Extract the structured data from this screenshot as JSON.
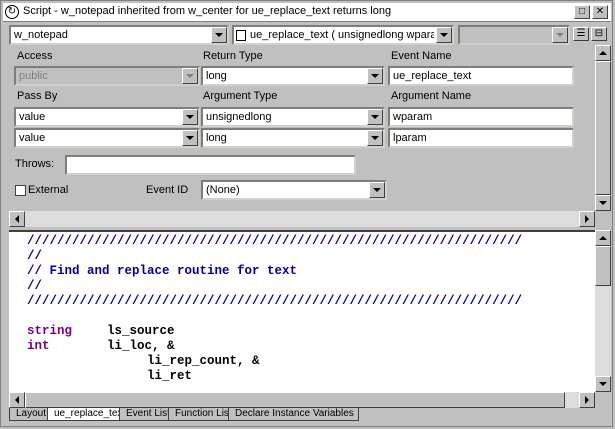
{
  "window": {
    "title": "Script - w_notepad inherited from w_center for ue_replace_text returns long"
  },
  "toolbar": {
    "object_select": "w_notepad",
    "event_select": "ue_replace_text ( unsignedlong wparar",
    "ancestor_select": ""
  },
  "labels": {
    "access": "Access",
    "return_type": "Return Type",
    "event_name": "Event Name",
    "pass_by": "Pass By",
    "argument_type": "Argument Type",
    "argument_name": "Argument Name",
    "throws": "Throws:",
    "external": "External",
    "event_id": "Event ID"
  },
  "fields": {
    "access": "public",
    "return_type": "long",
    "event_name": "ue_replace_text",
    "throws": "",
    "external_checked": false,
    "event_id": "(None)"
  },
  "arguments": [
    {
      "pass_by": "value",
      "type": "unsignedlong",
      "name": "wparam"
    },
    {
      "pass_by": "value",
      "type": "long",
      "name": "lparam"
    }
  ],
  "code": {
    "lines": [
      {
        "kind": "comment",
        "text": "//////////////////////////////////////////////////////////////////"
      },
      {
        "kind": "comment",
        "text": "//"
      },
      {
        "kind": "comment",
        "text": "// Find and replace routine for text"
      },
      {
        "kind": "comment",
        "text": "//"
      },
      {
        "kind": "comment",
        "text": "//////////////////////////////////////////////////////////////////"
      },
      {
        "kind": "blank",
        "text": ""
      },
      {
        "kind": "decl",
        "keyword": "string",
        "text": "ls_source"
      },
      {
        "kind": "decl",
        "keyword": "int",
        "text": "li_loc, &"
      },
      {
        "kind": "cont",
        "text": "li_rep_count, &"
      },
      {
        "kind": "cont",
        "text": "li_ret"
      }
    ]
  },
  "tabs": [
    {
      "label": "Layout"
    },
    {
      "label": "ue_replace_text"
    },
    {
      "label": "Event List"
    },
    {
      "label": "Function List"
    },
    {
      "label": "Declare Instance Variables"
    }
  ],
  "colors": {
    "comment": "#0000a0",
    "keyword": "#800080"
  }
}
